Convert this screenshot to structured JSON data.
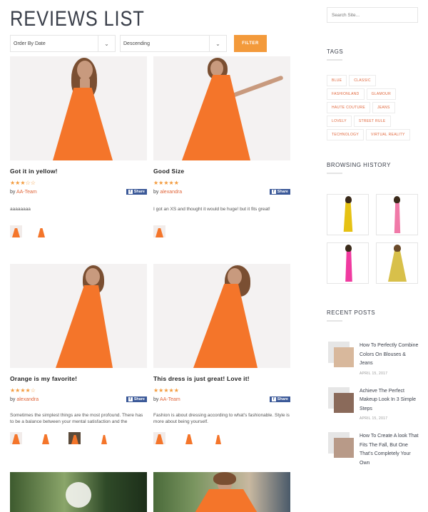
{
  "page_title": "REVIEWS LIST",
  "filters": {
    "order_by": "Order By Date",
    "order_dir": "Descending",
    "filter_label": "FILTER"
  },
  "colors": {
    "accent": "#f39a3b",
    "author": "#e0663b",
    "facebook": "#3b5998",
    "dress": "#f4752a"
  },
  "reviews": [
    {
      "title": "Got it in yellow!",
      "rating": 3,
      "by": "by",
      "author": "AA-Team",
      "share": "Share",
      "text": "aaaaaaaa"
    },
    {
      "title": "Good Size",
      "rating": 5,
      "by": "by",
      "author": "alexandra",
      "share": "Share",
      "text": "I got an XS and thought it would be huge! but it fits great!"
    },
    {
      "title": "Orange is my favorite!",
      "rating": 4,
      "by": "by",
      "author": "alexandra",
      "share": "Share",
      "text": "Sometimes the simplest things are the most profound. There has to be a balance between your mental satisfaction and the"
    },
    {
      "title": "This dress is just great! Love it!",
      "rating": 5,
      "by": "by",
      "author": "AA-Team",
      "share": "Share",
      "text": "Fashion is about dressing according to what's fashionable. Style is more about being yourself."
    }
  ],
  "sidebar": {
    "search_placeholder": "Search Site...",
    "tags_title": "TAGS",
    "tags": [
      "BLUE",
      "CLASSIC",
      "FASHIONLAND",
      "GLAMOUR",
      "HAUTE COUTURE",
      "JEANS",
      "LOVELY",
      "STREET RULE",
      "TECHNOLOGY",
      "VIRTUAL REALITY"
    ],
    "history_title": "BROWSING HISTORY",
    "history_colors": [
      "#e6c214",
      "#f07aa8",
      "#f03aa0",
      "#d8c04a"
    ],
    "posts_title": "RECENT POSTS",
    "posts": [
      {
        "title": "How To Perfectly Combine Colors On Blouses & Jeans",
        "date": "APRIL 15, 2017"
      },
      {
        "title": "Achieve The Perfect Makeup Look In 3 Simple Steps",
        "date": "APRIL 15, 2017"
      },
      {
        "title": "How To Create A look That Fits The Fall, But One That's Completely Your Own",
        "date": ""
      }
    ]
  }
}
